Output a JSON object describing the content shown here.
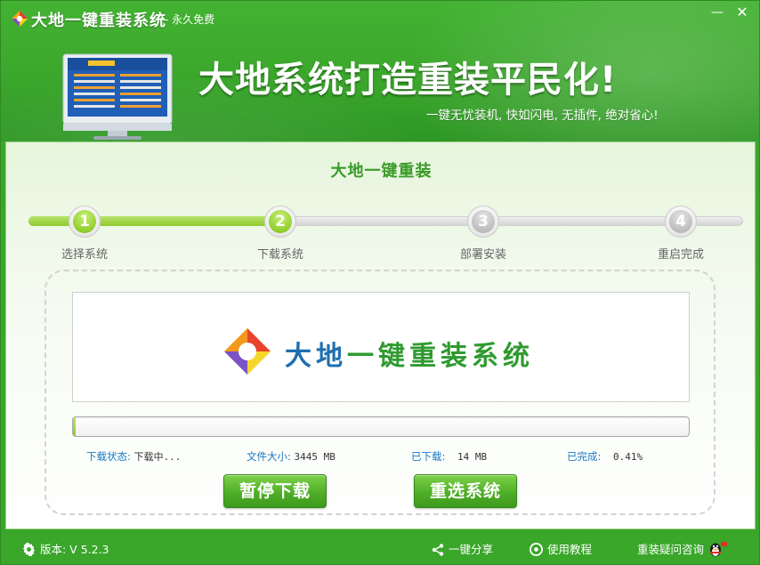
{
  "app": {
    "title": "大地一键重装系统",
    "subtitle": "- 永久免费",
    "minimize_glyph": "—",
    "close_glyph": "✕"
  },
  "header": {
    "slogan": "大地系统打造重装平民化!",
    "tagline": "一键无忧装机, 快如闪电, 无插件, 绝对省心!"
  },
  "main": {
    "title": "大地一键重装",
    "steps": [
      {
        "number": "1",
        "label": "选择系统",
        "state": "done"
      },
      {
        "number": "2",
        "label": "下载系统",
        "state": "done"
      },
      {
        "number": "3",
        "label": "部署安装",
        "state": "todo"
      },
      {
        "number": "4",
        "label": "重启完成",
        "state": "todo"
      }
    ],
    "banner": {
      "text_blue": "大地",
      "text_green": "一键重装系统"
    },
    "progress": {
      "fraction": 0.0041
    },
    "status": {
      "state_label": "下载状态:",
      "state_value": "下载中...",
      "size_label": "文件大小:",
      "size_value": "3445 MB",
      "downloaded_label": "已下载:",
      "downloaded_value": "14 MB",
      "complete_label": "已完成:",
      "complete_value": "0.41%"
    },
    "buttons": {
      "pause": "暂停下载",
      "reselect": "重选系统"
    }
  },
  "footer": {
    "version": "版本: V 5.2.3",
    "share": "一键分享",
    "tutorial": "使用教程",
    "consult": "重装疑问咨询"
  },
  "colors": {
    "brand_green": "#3aa62a",
    "step_active": "#92cf2c",
    "status_label_blue": "#1b78c4"
  }
}
